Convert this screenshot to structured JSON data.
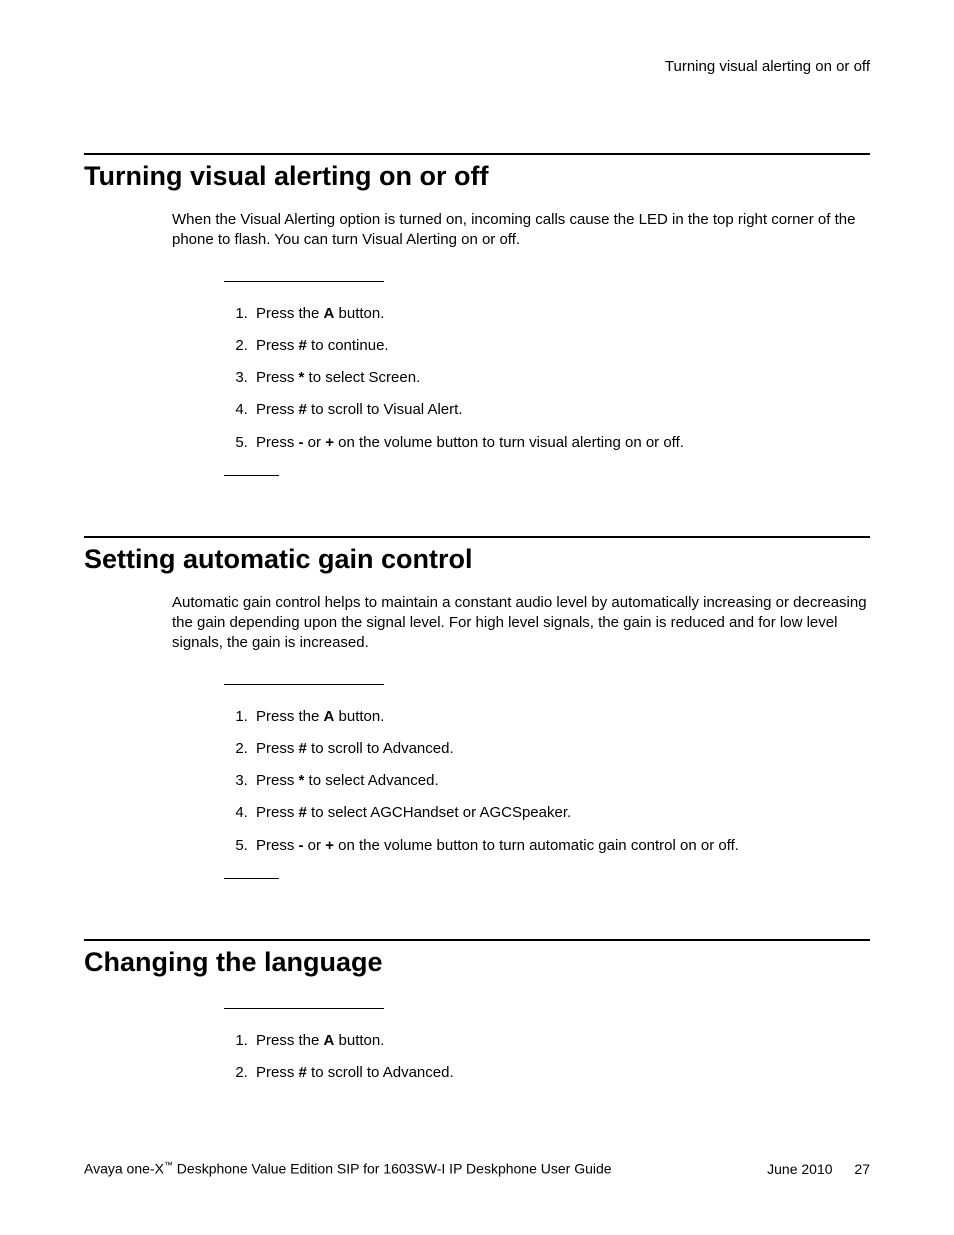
{
  "header": {
    "running_title": "Turning visual alerting on or off"
  },
  "sections": [
    {
      "heading": "Turning visual alerting on or off",
      "intro": "When the Visual Alerting option is turned on, incoming calls cause the LED in the top right corner of the phone to flash. You can turn Visual Alerting on or off.",
      "steps": [
        "Press the <b>A</b> button.",
        "Press <b>#</b> to continue.",
        "Press <b>*</b> to select Screen.",
        "Press <b>#</b> to scroll to Visual Alert.",
        "Press <b>-</b> or <b>+</b> on the volume button to turn visual alerting on or off."
      ]
    },
    {
      "heading": "Setting automatic gain control",
      "intro": "Automatic gain control helps to maintain a constant audio level by automatically increasing or decreasing the gain depending upon the signal level. For high level signals, the gain is reduced and for low level signals, the gain is increased.",
      "steps": [
        "Press the <b>A</b> button.",
        "Press <b>#</b> to scroll to Advanced.",
        "Press <b>*</b> to select Advanced.",
        "Press <b>#</b> to select AGCHandset or AGCSpeaker.",
        "Press <b>-</b> or <b>+</b> on the volume button to turn automatic gain control on or off."
      ]
    },
    {
      "heading": "Changing the language",
      "intro": "",
      "steps": [
        "Press the <b>A</b> button.",
        "Press <b>#</b> to scroll to Advanced."
      ]
    }
  ],
  "footer": {
    "product_prefix": "Avaya one-X",
    "tm": "™",
    "product_suffix": " Deskphone Value Edition SIP for 1603SW-I IP Deskphone User Guide",
    "date": "June 2010",
    "page": "27"
  }
}
